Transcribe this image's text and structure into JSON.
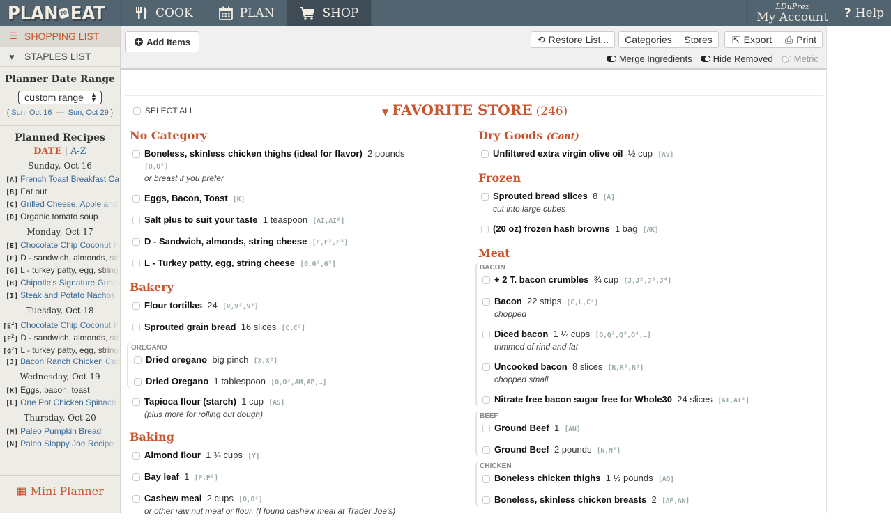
{
  "app": {
    "logo_left": "PLAN",
    "logo_mid": "to",
    "logo_right": "EAT"
  },
  "nav": {
    "tabs": [
      {
        "label": "COOK",
        "icon": "fork-knife-icon"
      },
      {
        "label": "PLAN",
        "icon": "calendar-icon"
      },
      {
        "label": "SHOP",
        "icon": "cart-icon",
        "active": true
      }
    ],
    "account_user": "LDuPrez",
    "account_label": "My Account",
    "help_label": "Help",
    "help_icon": "?"
  },
  "sidebar": {
    "links": [
      {
        "label": "SHOPPING LIST",
        "icon": "list-icon",
        "active": true
      },
      {
        "label": "STAPLES LIST",
        "icon": "heart-icon"
      }
    ],
    "date_range_title": "Planner Date Range",
    "date_range_select": "custom range",
    "range_start": "Sun, Oct 16",
    "range_sep": "—",
    "range_end": "Sun, Oct 29",
    "planned_title": "Planned Recipes",
    "sort_date": "DATE",
    "sort_sep": "|",
    "sort_az": "A-Z",
    "days": [
      {
        "label": "Sunday, Oct 16",
        "recipes": [
          {
            "tag": "A",
            "sup": "",
            "title": "French Toast Breakfast Ca",
            "link": true
          },
          {
            "tag": "B",
            "sup": "",
            "title": "Eat out",
            "link": false
          },
          {
            "tag": "C",
            "sup": "",
            "title": "Grilled Cheese, Apple and",
            "link": true
          },
          {
            "tag": "D",
            "sup": "",
            "title": "Organic tomato soup",
            "link": false
          }
        ]
      },
      {
        "label": "Monday, Oct 17",
        "recipes": [
          {
            "tag": "E",
            "sup": "",
            "title": "Chocolate Chip Coconut F",
            "link": true
          },
          {
            "tag": "F",
            "sup": "",
            "title": "D - sandwich, almonds, str",
            "link": false
          },
          {
            "tag": "G",
            "sup": "",
            "title": "L - turkey patty, egg, string",
            "link": false
          },
          {
            "tag": "H",
            "sup": "",
            "title": "Chipotle's Signature Guaca",
            "link": true
          },
          {
            "tag": "I",
            "sup": "",
            "title": "Steak and Potato Nachos",
            "link": true
          }
        ]
      },
      {
        "label": "Tuesday, Oct 18",
        "recipes": [
          {
            "tag": "E",
            "sup": "2",
            "title": "Chocolate Chip Coconut F",
            "link": true
          },
          {
            "tag": "F",
            "sup": "2",
            "title": "D - sandwich, almonds, str",
            "link": false
          },
          {
            "tag": "G",
            "sup": "2",
            "title": "L - turkey patty, egg, string",
            "link": false
          },
          {
            "tag": "J",
            "sup": "",
            "title": "Bacon Ranch Chicken Cas",
            "link": true
          }
        ]
      },
      {
        "label": "Wednesday, Oct 19",
        "recipes": [
          {
            "tag": "K",
            "sup": "",
            "title": "Eggs, bacon, toast",
            "link": false
          },
          {
            "tag": "L",
            "sup": "",
            "title": "One Pot Chicken Spinach",
            "link": true
          }
        ]
      },
      {
        "label": "Thursday, Oct 20",
        "recipes": [
          {
            "tag": "M",
            "sup": "",
            "title": "Paleo Pumpkin Bread",
            "link": true
          },
          {
            "tag": "N",
            "sup": "",
            "title": "Paleo Sloppy Joe Recipe",
            "link": true
          }
        ]
      }
    ],
    "mini_planner": "Mini Planner"
  },
  "toolbar": {
    "add_items": "Add Items",
    "restore": "Restore List...",
    "categories": "Categories",
    "stores": "Stores",
    "export": "Export",
    "print": "Print",
    "toggles": [
      {
        "label": "Merge Ingredients",
        "on": true
      },
      {
        "label": "Hide Removed",
        "on": true
      },
      {
        "label": "Metric",
        "on": false
      }
    ]
  },
  "list": {
    "select_all": "SELECT ALL",
    "store_name": "FAVORITE STORE",
    "store_count": "(246)",
    "left_column": [
      {
        "category": "No Category",
        "cont": "",
        "groups": [
          {
            "header": "",
            "items": [
              {
                "name": "Boneless, skinless chicken thighs (ideal for flavor)",
                "qty": "2 pounds",
                "refs": "[O,O²]",
                "note": "or breast if you prefer",
                "wrap": true
              },
              {
                "name": "Eggs, Bacon, Toast",
                "qty": "",
                "refs": "[K]",
                "note": ""
              },
              {
                "name": "Salt plus to suit your taste",
                "qty": "1 teaspoon",
                "refs": "[AI,AI²]",
                "note": ""
              },
              {
                "name": "D - Sandwich, almonds, string cheese",
                "qty": "",
                "refs": "[F,F²,F³]",
                "note": ""
              },
              {
                "name": "L - Turkey patty, egg, string cheese",
                "qty": "",
                "refs": "[G,G²,G³]",
                "note": ""
              }
            ]
          }
        ]
      },
      {
        "category": "Bakery",
        "cont": "",
        "groups": [
          {
            "header": "",
            "items": [
              {
                "name": "Flour tortillas",
                "qty": "24",
                "refs": "[V,V²,V³]",
                "note": ""
              },
              {
                "name": "Sprouted grain bread",
                "qty": "16 slices",
                "refs": "[C,C²]",
                "note": ""
              }
            ]
          },
          {
            "header": "OREGANO",
            "items": [
              {
                "name": "Dried oregano",
                "qty": "big pinch",
                "refs": "[X,X²]",
                "note": ""
              },
              {
                "name": "Dried Oregano",
                "qty": "1 tablespoon",
                "refs": "[O,O²,AM,AP,…]",
                "note": ""
              }
            ]
          },
          {
            "header": "",
            "items": [
              {
                "name": "Tapioca flour (starch)",
                "qty": "1 cup",
                "refs": "[AS]",
                "note": "(plus more for rolling out dough)"
              }
            ]
          }
        ]
      },
      {
        "category": "Baking",
        "cont": "",
        "groups": [
          {
            "header": "",
            "items": [
              {
                "name": "Almond flour",
                "qty": "1 ¾ cups",
                "refs": "[Y]",
                "note": ""
              },
              {
                "name": "Bay leaf",
                "qty": "1",
                "refs": "[P,P²]",
                "note": ""
              },
              {
                "name": "Cashew meal",
                "qty": "2 cups",
                "refs": "[O,O²]",
                "note": "or other raw nut meal or flour, (I found cashew meal at Trader Joe's)"
              }
            ]
          }
        ]
      }
    ],
    "right_column": [
      {
        "category": "Dry Goods",
        "cont": "(Cont)",
        "groups": [
          {
            "header": "",
            "items": [
              {
                "name": "Unfiltered extra virgin olive oil",
                "qty": "½ cup",
                "refs": "[AV]",
                "note": ""
              }
            ]
          }
        ]
      },
      {
        "category": "Frozen",
        "cont": "",
        "groups": [
          {
            "header": "",
            "items": [
              {
                "name": "Sprouted bread slices",
                "qty": "8",
                "refs": "[A]",
                "note": "cut into large cubes"
              },
              {
                "name": "(20 oz) frozen hash browns",
                "qty": "1 bag",
                "refs": "[AK]",
                "note": ""
              }
            ]
          }
        ]
      },
      {
        "category": "Meat",
        "cont": "",
        "groups": [
          {
            "header": "BACON",
            "items": [
              {
                "name": "+ 2 T. bacon crumbles",
                "qty": "¾ cup",
                "refs": "[J,J²,J³,J⁴]",
                "note": ""
              },
              {
                "name": "Bacon",
                "qty": "22 strips",
                "refs": "[C,L,C²]",
                "note": "chopped"
              },
              {
                "name": "Diced bacon",
                "qty": "1 ¼ cups",
                "refs": "[Q,Q²,Q³,Q⁴,…]",
                "note": "trimmed of rind and fat"
              },
              {
                "name": "Uncooked bacon",
                "qty": "8 slices",
                "refs": "[R,R²,R³]",
                "note": "chopped small"
              },
              {
                "name": "Nitrate free bacon sugar free for Whole30",
                "qty": "24 slices",
                "refs": "[AI,AI²]",
                "note": ""
              }
            ]
          },
          {
            "header": "BEEF",
            "items": [
              {
                "name": "Ground Beef",
                "qty": "1",
                "refs": "[AN]",
                "note": ""
              },
              {
                "name": "Ground Beef",
                "qty": "2 pounds",
                "refs": "[N,N²]",
                "note": ""
              }
            ]
          },
          {
            "header": "CHICKEN",
            "items": [
              {
                "name": "Boneless chicken thighs",
                "qty": "1 ½ pounds",
                "refs": "[AQ]",
                "note": ""
              },
              {
                "name": "Boneless, skinless chicken breasts",
                "qty": "2",
                "refs": "[AF,AN]",
                "note": ""
              }
            ]
          }
        ]
      }
    ]
  },
  "colors": {
    "accent": "#c9552f",
    "topbar": "#536471",
    "link": "#3a6a9a",
    "sidebar_bg": "#eeece6"
  }
}
